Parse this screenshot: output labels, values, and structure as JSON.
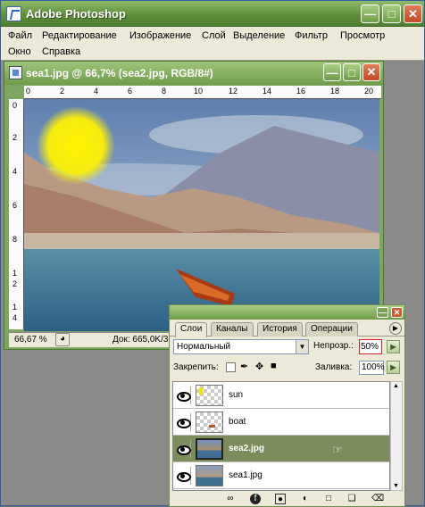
{
  "app": {
    "title": "Adobe Photoshop"
  },
  "menu": [
    "Файл",
    "Редактирование",
    "Изображение",
    "Слой",
    "Выделение",
    "Фильтр",
    "Просмотр",
    "Окно",
    "Справка"
  ],
  "document": {
    "title": "sea1.jpg @ 66,7% (sea2.jpg, RGB/8#)",
    "ruler_h": [
      "0",
      "2",
      "4",
      "6",
      "8",
      "10",
      "12",
      "14",
      "16",
      "18",
      "20"
    ],
    "ruler_v": [
      "0",
      "2",
      "4",
      "6",
      "8",
      "1",
      "2",
      "1",
      "4"
    ],
    "zoom": "66,67 %",
    "doc_info": "Док: 665,0K/3,"
  },
  "layers_panel": {
    "tabs": [
      "Слои",
      "Каналы",
      "История",
      "Операции"
    ],
    "blend_mode": "Нормальный",
    "opacity_label": "Непрозр.:",
    "opacity_value": "50%",
    "lock_label": "Закрепить:",
    "fill_label": "Заливка:",
    "fill_value": "100%",
    "layers": [
      {
        "name": "sun",
        "selected": false
      },
      {
        "name": "boat",
        "selected": false
      },
      {
        "name": "sea2.jpg",
        "selected": true
      },
      {
        "name": "sea1.jpg",
        "selected": false
      }
    ]
  },
  "colors": {
    "title_green": "#6f9c4a",
    "selection": "#7d8c5c",
    "highlight": "#e02020"
  }
}
